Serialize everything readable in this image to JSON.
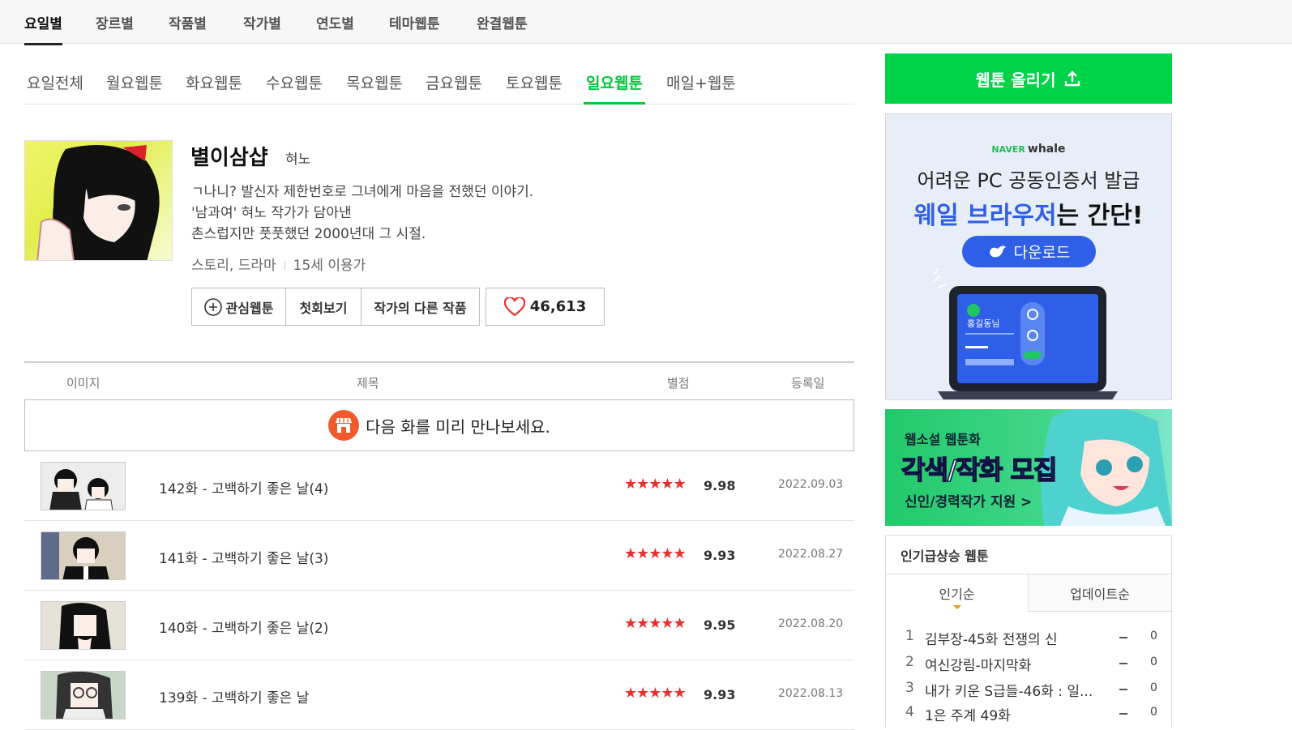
{
  "top_nav": [
    "요일별",
    "장르별",
    "작품별",
    "작가별",
    "연도별",
    "테마웹툰",
    "완결웹툰"
  ],
  "day_tabs": [
    "요일전체",
    "월요웹툰",
    "화요웹툰",
    "수요웹툰",
    "목요웹툰",
    "금요웹툰",
    "토요웹툰",
    "일요웹툰",
    "매일+웹툰"
  ],
  "active_day_tab": "일요웹툰",
  "comic": {
    "title": "별이삼샵",
    "author": "혀노",
    "synopsis": [
      "ㄱ나니? 발신자 제한번호로 그녀에게 마음을 전했던 이야기.",
      "'남과여' 혀노 작가가 담아낸",
      "촌스럽지만 풋풋했던 2000년대 그 시절."
    ],
    "genre": "스토리, 드라마",
    "age": "15세 이용가",
    "buttons": {
      "favorite": "관심웹툰",
      "first": "첫회보기",
      "other": "작가의 다른 작품"
    },
    "likes": "46,613"
  },
  "table": {
    "headers": {
      "image": "이미지",
      "title": "제목",
      "rating": "별점",
      "date": "등록일"
    },
    "preview_text": "다음 화를 미리 만나보세요.",
    "episodes": [
      {
        "title": "142화 - 고백하기 좋은 날(4)",
        "stars": "★★★★★",
        "score": "9.98",
        "date": "2022.09.03"
      },
      {
        "title": "141화 - 고백하기 좋은 날(3)",
        "stars": "★★★★★",
        "score": "9.93",
        "date": "2022.08.27"
      },
      {
        "title": "140화 - 고백하기 좋은 날(2)",
        "stars": "★★★★★",
        "score": "9.95",
        "date": "2022.08.20"
      },
      {
        "title": "139화 - 고백하기 좋은 날",
        "stars": "★★★★★",
        "score": "9.93",
        "date": "2022.08.13"
      }
    ]
  },
  "sidebar": {
    "upload_label": "웹툰 올리기",
    "ad_whale": {
      "brand_naver": "NAVER",
      "brand_whale": "whale",
      "line1": "어려운 PC 공동인증서 발급",
      "line2_highlight": "웨일 브라우저",
      "line2_rest": "는 간단!",
      "download": "다운로드",
      "laptop_name": "홍길동님"
    },
    "ad_novel": {
      "line1": "웹소설 웹툰화",
      "line2": "각색/작화 모집",
      "line3": "신인/경력작가 지원 >"
    },
    "rank": {
      "heading": "인기급상승 웹툰",
      "tab_popular": "인기순",
      "tab_update": "업데이트순",
      "items": [
        {
          "n": "1",
          "title": "김부장-45화 전쟁의 신",
          "change": "0"
        },
        {
          "n": "2",
          "title": "여신강림-마지막화",
          "change": "0"
        },
        {
          "n": "3",
          "title": "내가 키운 S급들-46화 : 일...",
          "change": "0"
        },
        {
          "n": "4",
          "title": "1은 주계 49화",
          "change": "0"
        }
      ]
    }
  },
  "colors": {
    "accent": "#00c73c",
    "star": "#e6312f",
    "whale_blue": "#2f5ee8"
  }
}
